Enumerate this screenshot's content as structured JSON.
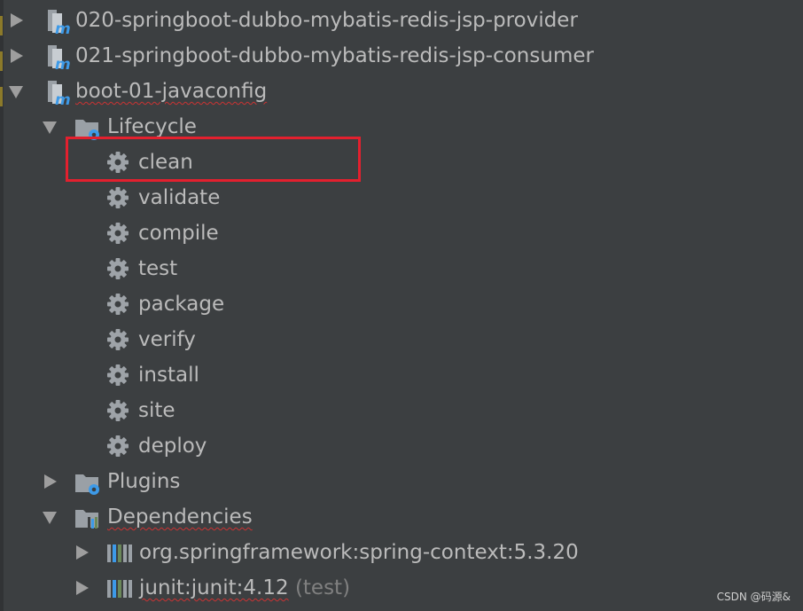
{
  "tree": {
    "modules": [
      {
        "label": "020-springboot-dubbo-mybatis-redis-jsp-provider",
        "state": "collapsed",
        "icon": "maven-module-icon"
      },
      {
        "label": "021-springboot-dubbo-mybatis-redis-jsp-consumer",
        "state": "collapsed",
        "icon": "maven-module-icon"
      },
      {
        "label": "boot-01-javaconfig",
        "state": "expanded",
        "icon": "maven-module-icon"
      }
    ],
    "lifecycle": {
      "label": "Lifecycle",
      "state": "expanded",
      "icon": "folder-gear-icon",
      "phases": [
        "clean",
        "validate",
        "compile",
        "test",
        "package",
        "verify",
        "install",
        "site",
        "deploy"
      ],
      "highlighted_phase": "clean"
    },
    "plugins": {
      "label": "Plugins",
      "state": "collapsed",
      "icon": "folder-gear-icon"
    },
    "dependencies": {
      "label": "Dependencies",
      "state": "expanded",
      "icon": "dependencies-icon",
      "items": [
        {
          "label": "org.springframework:spring-context:5.3.20",
          "scope": ""
        },
        {
          "label": "junit:junit:4.12",
          "scope": "(test)"
        }
      ]
    }
  },
  "watermark": "CSDN @码源&",
  "colors": {
    "background": "#3c3f41",
    "text": "#bbbbbb",
    "gear": "#9ea3a8",
    "maven_blue": "#3d9ae8",
    "highlight": "#e3202e"
  }
}
